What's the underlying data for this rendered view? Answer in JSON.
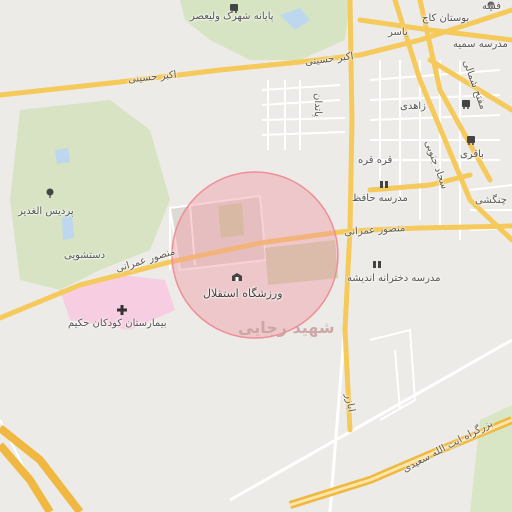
{
  "map": {
    "accent_road_color": "#f5c95a",
    "minor_road_color": "#ffffff",
    "park_color": "#cfe2b6",
    "hospital_color": "#f6c2dc",
    "radius_circle_color": "#f2a0a6",
    "labels": {
      "park_top": "پایانه شهرک ولیعصر",
      "top_right_park": "بوستان کاج",
      "top_right_fragment": "فشه",
      "school_top_right": "مدرسه سمیه",
      "yas": "یاسر",
      "akbar_hosseini_left": "اکبر حسینی",
      "akbar_hosseini_right": "اکبر حسینی",
      "zahedi": "زاهدی",
      "baqeri": "باقری",
      "qarrah": "قره قره",
      "hafez_school": "مدرسه حافظ",
      "gonbadi": "چنگشی",
      "mansour_amrani_left": "منصور عمرانی",
      "mansour_amrani_right": "منصور عمرانی",
      "alghadir": "پردیس الغدیر",
      "dastshooyi": "دستشویی",
      "stadium": "ورزشگاه استقلال",
      "andisheh_school": "مدرسه دخترانه اندیشه",
      "hospital": "بیمارستان کودکان حکیم",
      "district": "شهید رجایی",
      "ayatollah_saeedi": "بزرگراه ایت الله سعیدی",
      "abazar": "ابازر",
      "vertical_street": "پاتدان",
      "mofateh": "مفتح شمالی",
      "sajjad": "سجاد جنوبی"
    }
  }
}
